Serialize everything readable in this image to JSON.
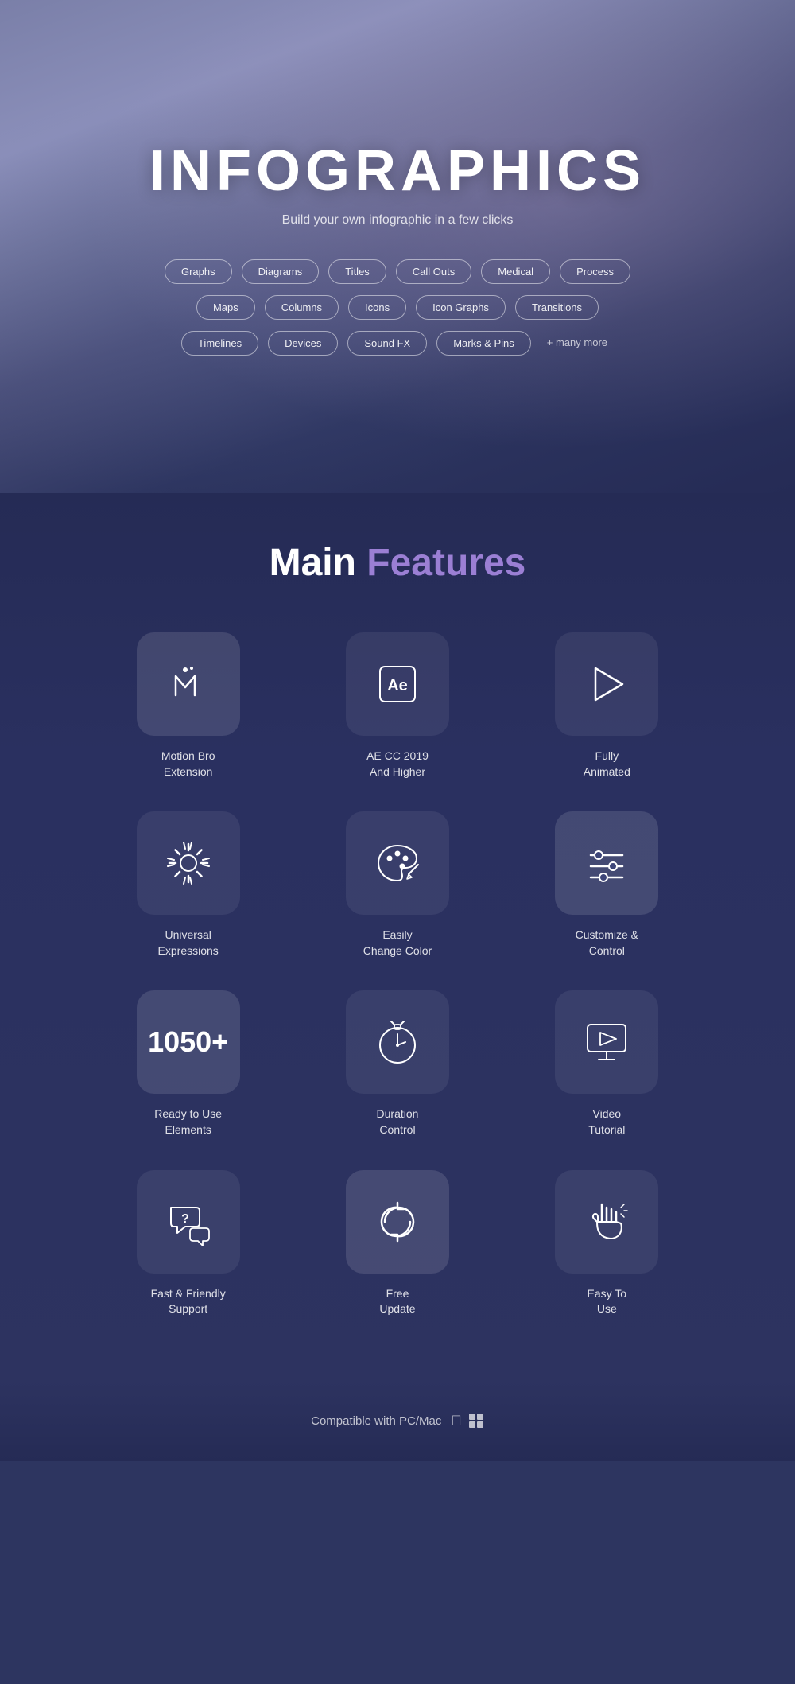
{
  "hero": {
    "title": "INFOGRAPHICS",
    "subtitle": "Build your own infographic in a few clicks",
    "tags_row1": [
      "Graphs",
      "Diagrams",
      "Titles",
      "Call Outs",
      "Medical",
      "Process"
    ],
    "tags_row2": [
      "Maps",
      "Columns",
      "Icons",
      "Icon Graphs",
      "Transitions"
    ],
    "tags_row3": [
      "Timelines",
      "Devices",
      "Sound FX",
      "Marks & Pins"
    ],
    "tags_more": "+ many more"
  },
  "features": {
    "section_title_main": "Main ",
    "section_title_accent": "Features",
    "items": [
      {
        "id": "motion-bro",
        "label": "Motion Bro Extension",
        "active": true,
        "icon": "motion-bro-icon",
        "number": null
      },
      {
        "id": "ae-cc",
        "label": "AE CC 2019 And Higher",
        "active": false,
        "icon": "ae-icon",
        "number": null
      },
      {
        "id": "fully-animated",
        "label": "Fully Animated",
        "active": false,
        "icon": "play-icon",
        "number": null
      },
      {
        "id": "universal-expressions",
        "label": "Universal Expressions",
        "active": false,
        "icon": "gear-icon",
        "number": null
      },
      {
        "id": "change-color",
        "label": "Easily Change Color",
        "active": false,
        "icon": "palette-icon",
        "number": null
      },
      {
        "id": "customize",
        "label": "Customize & Control",
        "active": true,
        "icon": "sliders-icon",
        "number": null
      },
      {
        "id": "elements",
        "label": "Ready to Use Elements",
        "active": true,
        "icon": "number-icon",
        "number": "1050+"
      },
      {
        "id": "duration",
        "label": "Duration Control",
        "active": false,
        "icon": "stopwatch-icon",
        "number": null
      },
      {
        "id": "video-tutorial",
        "label": "Video Tutorial",
        "active": false,
        "icon": "monitor-icon",
        "number": null
      },
      {
        "id": "friendly-support",
        "label": "Fast & Friendly Support",
        "active": false,
        "icon": "support-icon",
        "number": null
      },
      {
        "id": "free-update",
        "label": "Free Update",
        "active": true,
        "icon": "update-icon",
        "number": null
      },
      {
        "id": "easy-to-use",
        "label": "Easy To Use",
        "active": false,
        "icon": "hand-icon",
        "number": null
      }
    ]
  },
  "compatible": {
    "text": "Compatible with PC/Mac"
  }
}
